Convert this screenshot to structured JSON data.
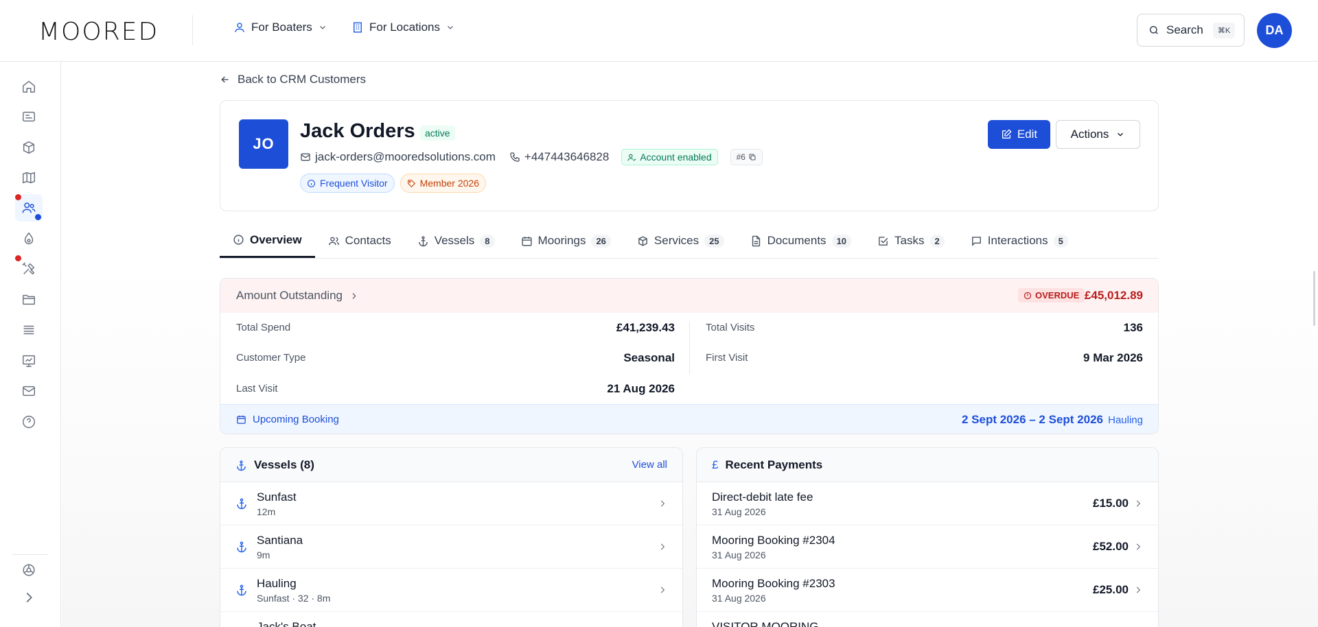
{
  "app": {
    "logo_text": "MOORED"
  },
  "topnav": {
    "boaters_label": "For Boaters",
    "locations_label": "For Locations",
    "search_label": "Search",
    "search_shortcut": "⌘K",
    "user_initials": "DA"
  },
  "sidebar": {
    "items": [
      "home-icon",
      "dashboard-icon",
      "box-icon",
      "map-icon",
      "users-icon",
      "droplet-icon",
      "tools-icon",
      "folder-icon",
      "list-icon",
      "chart-icon",
      "mail-icon",
      "help-icon",
      "settings-icon",
      "expand-icon"
    ]
  },
  "back_link": "Back to CRM Customers",
  "customer": {
    "initials": "JO",
    "name": "Jack Orders",
    "status": "active",
    "email": "jack-orders@mooredsolutions.com",
    "phone": "+447443646828",
    "account_status": "Account enabled",
    "id": "#6",
    "tags": [
      "Frequent Visitor",
      "Member 2026"
    ]
  },
  "header_actions": {
    "edit": "Edit",
    "actions": "Actions"
  },
  "tabs": [
    {
      "label": "Overview",
      "count": ""
    },
    {
      "label": "Contacts",
      "count": ""
    },
    {
      "label": "Vessels",
      "count": "8"
    },
    {
      "label": "Moorings",
      "count": "26"
    },
    {
      "label": "Services",
      "count": "25"
    },
    {
      "label": "Documents",
      "count": "10"
    },
    {
      "label": "Tasks",
      "count": "2"
    },
    {
      "label": "Interactions",
      "count": "5"
    }
  ],
  "outstanding": {
    "title": "Amount Outstanding",
    "overdue_label": "OVERDUE",
    "amount": "£45,012.89",
    "colors": {
      "overdue": "#b91c1c",
      "accent": "#1d4ed8"
    }
  },
  "stats": {
    "total_spend_label": "Total Spend",
    "total_spend": "£41,239.43",
    "customer_type_label": "Customer Type",
    "customer_type": "Seasonal",
    "last_visit_label": "Last Visit",
    "last_visit": "21 Aug 2026",
    "total_visits_label": "Total Visits",
    "total_visits": "136",
    "first_visit_label": "First Visit",
    "first_visit": "9 Mar 2026"
  },
  "upcoming": {
    "label": "Upcoming Booking",
    "dates": "2 Sept 2026 – 2 Sept 2026",
    "type": "Hauling"
  },
  "vessels": {
    "title": "Vessels (8)",
    "view_all": "View all",
    "items": [
      {
        "name": "Sunfast",
        "sub": "12m"
      },
      {
        "name": "Santiana",
        "sub": "9m"
      },
      {
        "name": "Hauling",
        "sub": "Sunfast · 32 · 8m"
      },
      {
        "name": "Jack's Boat",
        "sub": ""
      }
    ]
  },
  "payments": {
    "title": "Recent Payments",
    "items": [
      {
        "name": "Direct-debit late fee",
        "date": "31 Aug 2026",
        "amount": "£15.00"
      },
      {
        "name": "Mooring Booking #2304",
        "date": "31 Aug 2026",
        "amount": "£52.00"
      },
      {
        "name": "Mooring Booking #2303",
        "date": "31 Aug 2026",
        "amount": "£25.00"
      },
      {
        "name": "VISITOR MOORING",
        "date": "",
        "amount": ""
      }
    ]
  }
}
